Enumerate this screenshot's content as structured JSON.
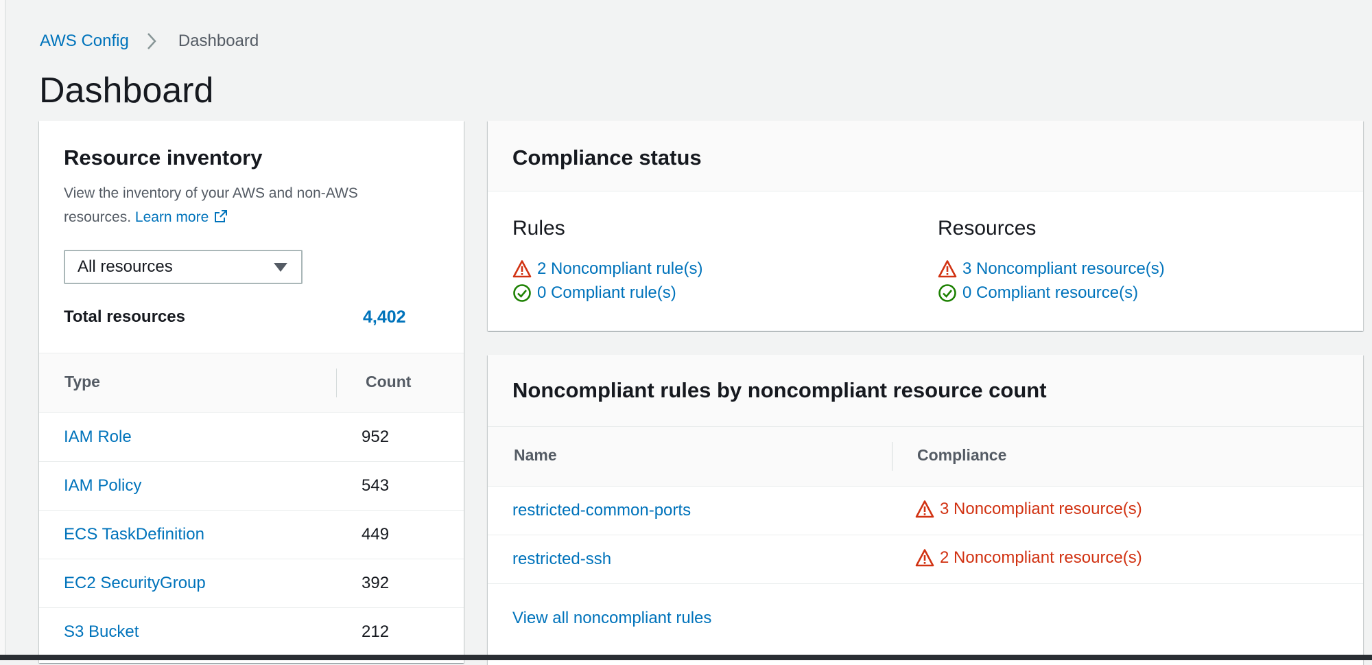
{
  "breadcrumb": {
    "root": "AWS Config",
    "current": "Dashboard"
  },
  "page": {
    "title": "Dashboard"
  },
  "inventory": {
    "title": "Resource inventory",
    "description": "View the inventory of your AWS and non-AWS resources.",
    "learn_more": "Learn more",
    "filter_value": "All resources",
    "total_label": "Total resources",
    "total_value": "4,402",
    "columns": [
      "Type",
      "Count"
    ],
    "rows": [
      {
        "type": "IAM Role",
        "count": "952"
      },
      {
        "type": "IAM Policy",
        "count": "543"
      },
      {
        "type": "ECS TaskDefinition",
        "count": "449"
      },
      {
        "type": "EC2 SecurityGroup",
        "count": "392"
      },
      {
        "type": "S3 Bucket",
        "count": "212"
      }
    ]
  },
  "compliance": {
    "title": "Compliance status",
    "rules_heading": "Rules",
    "rules_noncompliant": "2 Noncompliant rule(s)",
    "rules_compliant": "0 Compliant rule(s)",
    "resources_heading": "Resources",
    "resources_noncompliant": "3 Noncompliant resource(s)",
    "resources_compliant": "0 Compliant resource(s)"
  },
  "noncompliant_rules": {
    "title": "Noncompliant rules by noncompliant resource count",
    "columns": [
      "Name",
      "Compliance"
    ],
    "rows": [
      {
        "name": "restricted-common-ports",
        "compliance": "3 Noncompliant resource(s)"
      },
      {
        "name": "restricted-ssh",
        "compliance": "2 Noncompliant resource(s)"
      }
    ],
    "view_all": "View all noncompliant rules"
  },
  "icons": {
    "warning": "warning-triangle-icon",
    "success": "check-circle-icon",
    "external": "external-link-icon",
    "breadcrumb_separator": "chevron-right-icon",
    "dropdown": "caret-down-icon"
  },
  "colors": {
    "link": "#0073bb",
    "error": "#d13212",
    "success": "#1d8102",
    "background": "#f2f3f3"
  }
}
